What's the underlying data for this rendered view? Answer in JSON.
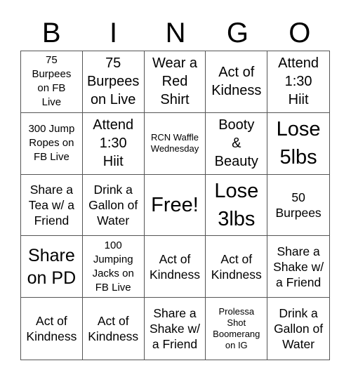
{
  "header": {
    "letters": [
      "B",
      "I",
      "N",
      "G",
      "O"
    ]
  },
  "cells": [
    {
      "text": "75\nBurpees\non FB\nLive",
      "size": "s15"
    },
    {
      "text": "75\nBurpees\non Live",
      "size": "s20"
    },
    {
      "text": "Wear a\nRed\nShirt",
      "size": "s20"
    },
    {
      "text": "Act of\nKidness",
      "size": "s20"
    },
    {
      "text": "Attend\n1:30\nHiit",
      "size": "s20"
    },
    {
      "text": "300 Jump\nRopes on\nFB Live",
      "size": "s15"
    },
    {
      "text": "Attend\n1:30\nHiit",
      "size": "s20"
    },
    {
      "text": "RCN Waffle\nWednesday",
      "size": "s13"
    },
    {
      "text": "Booty\n&\nBeauty",
      "size": "s20"
    },
    {
      "text": "Lose\n5lbs",
      "size": "s29"
    },
    {
      "text": "Share a\nTea w/ a\nFriend",
      "size": "s17"
    },
    {
      "text": "Drink a\nGallon of\nWater",
      "size": "s17"
    },
    {
      "text": "Free!",
      "size": "s29"
    },
    {
      "text": "Lose\n3lbs",
      "size": "s29"
    },
    {
      "text": "50\nBurpees",
      "size": "s17"
    },
    {
      "text": "Share\non PD",
      "size": "s24"
    },
    {
      "text": "100\nJumping\nJacks on\nFB Live",
      "size": "s15"
    },
    {
      "text": "Act of\nKindness",
      "size": "s17"
    },
    {
      "text": "Act of\nKindness",
      "size": "s17"
    },
    {
      "text": "Share a\nShake w/\na Friend",
      "size": "s17"
    },
    {
      "text": "Act of\nKindness",
      "size": "s17"
    },
    {
      "text": "Act of\nKindness",
      "size": "s17"
    },
    {
      "text": "Share a\nShake w/\na Friend",
      "size": "s17"
    },
    {
      "text": "Prolessa\nShot\nBoomerang\non IG",
      "size": "s13"
    },
    {
      "text": "Drink a\nGallon of\nWater",
      "size": "s17"
    }
  ]
}
